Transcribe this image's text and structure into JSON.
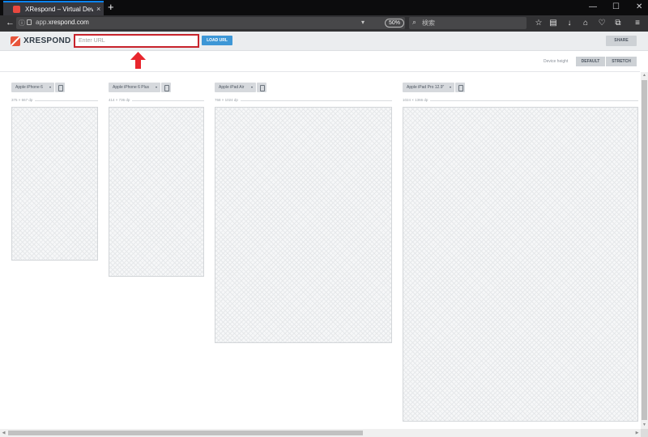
{
  "browser": {
    "tab_title": "XRespond – Virtual Device L",
    "tab_close_glyph": "×",
    "new_tab_glyph": "+",
    "window_controls": {
      "minimize": "—",
      "maximize": "☐",
      "close": "✕"
    },
    "back_glyph": "←",
    "info_glyph": "ⓘ",
    "url_prefix": "app.",
    "url_domain": "xrespond.com",
    "url_dropdown_glyph": "▾",
    "zoom": "50%",
    "reload_glyph": "↻",
    "search_glyph": "⌕",
    "search_placeholder": "検索",
    "toolbar_glyphs": {
      "bookmark": "☆",
      "reading": "▤",
      "download": "↓",
      "home": "⌂",
      "pocket": "♡",
      "screenshot": "⧉",
      "menu": "≡"
    }
  },
  "app": {
    "brand": "XRESPOND",
    "url_placeholder": "Enter URL",
    "load_label": "LOAD URL",
    "share_label": "SHARE",
    "device_height_label": "Device height",
    "height_modes": [
      "DEFAULT",
      "STRETCH"
    ],
    "accent_color": "#3d97d6",
    "highlight_color": "#c8232c",
    "scroll_glyphs": {
      "up": "▲",
      "down": "▼",
      "left": "◀",
      "right": "▶"
    },
    "devices": [
      {
        "name": "Apple iPhone 6",
        "size": "375 × 667 dp"
      },
      {
        "name": "Apple iPhone 6 Plus",
        "size": "414 × 736 dp"
      },
      {
        "name": "Apple iPad Air",
        "size": "768 × 1024 dp"
      },
      {
        "name": "Apple iPad Pro 12.9\"",
        "size": "1024 × 1366 dp"
      }
    ]
  }
}
